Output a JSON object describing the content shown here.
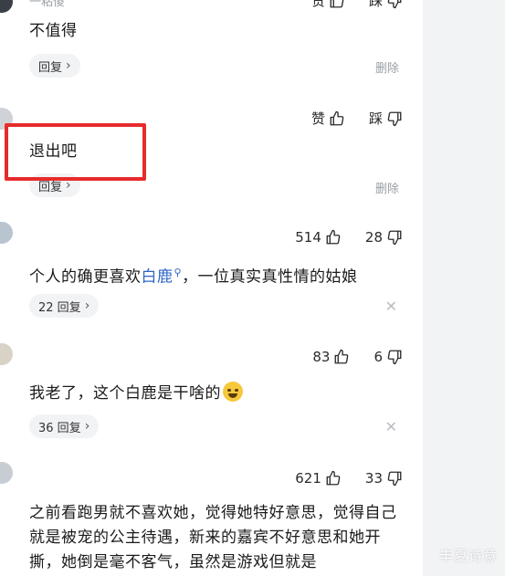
{
  "comments": [
    {
      "name": "一粘傻",
      "text": "不值得",
      "likes": "赞",
      "dislikes": "踩",
      "reply_label": "回复",
      "delete_label": "删除"
    },
    {
      "name": "",
      "text": "退出吧",
      "likes": "赞",
      "dislikes": "踩",
      "reply_label": "回复",
      "delete_label": "删除"
    },
    {
      "name": "",
      "text_before": "个人的确更喜欢",
      "link": "白鹿",
      "text_after": "，一位真实真性情的姑娘",
      "likes": "514",
      "dislikes": "28",
      "reply_label": "22 回复"
    },
    {
      "name": "",
      "text": "我老了，这个白鹿是干啥的",
      "likes": "83",
      "dislikes": "6",
      "reply_label": "36 回复"
    },
    {
      "name": "",
      "text": "之前看跑男就不喜欢她，觉得她特好意思，觉得自己就是被宠的公主待遇，新来的嘉宾不好意思和她开撕，她倒是毫不客气，虽然是游戏但就是",
      "likes": "621",
      "dislikes": "33"
    }
  ],
  "icons": {
    "like": "thumbs-up-icon",
    "dislike": "thumbs-down-icon",
    "search": "search-icon",
    "close": "close-icon",
    "chevron": "chevron-right-icon",
    "emoji": "laughing-crying-emoji"
  },
  "watermark": "丰夏诗意",
  "colors": {
    "highlight_box": "#e62b2b",
    "link": "#2d64c8",
    "muted": "#9aa0a6",
    "side_panel": "#f2f3f5"
  }
}
